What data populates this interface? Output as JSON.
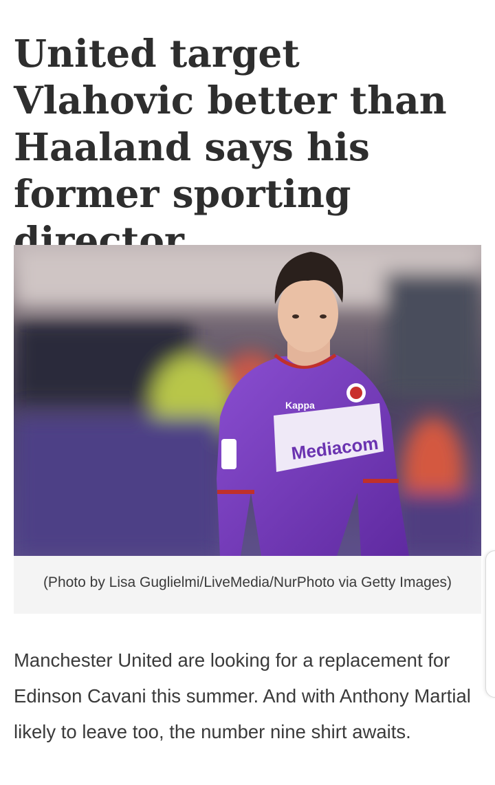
{
  "article": {
    "headline": "United target Vlahovic better than Haaland says his former sporting director",
    "photo": {
      "jersey_sponsor": "Mediacom",
      "kit_brand": "Kappa"
    },
    "caption": "(Photo by Lisa Guglielmi/LiveMedia/NurPhoto via Getty Images)",
    "body": "Manchester United are looking for a replacement for Edinson Cavani this summer. And with Anthony Martial likely to leave too, the number nine shirt awaits."
  },
  "colors": {
    "headline": "#2e2e2e",
    "body_text": "#3a3a3a",
    "caption_bg": "#f4f4f4",
    "jersey_purple": "#7a3fc0"
  }
}
